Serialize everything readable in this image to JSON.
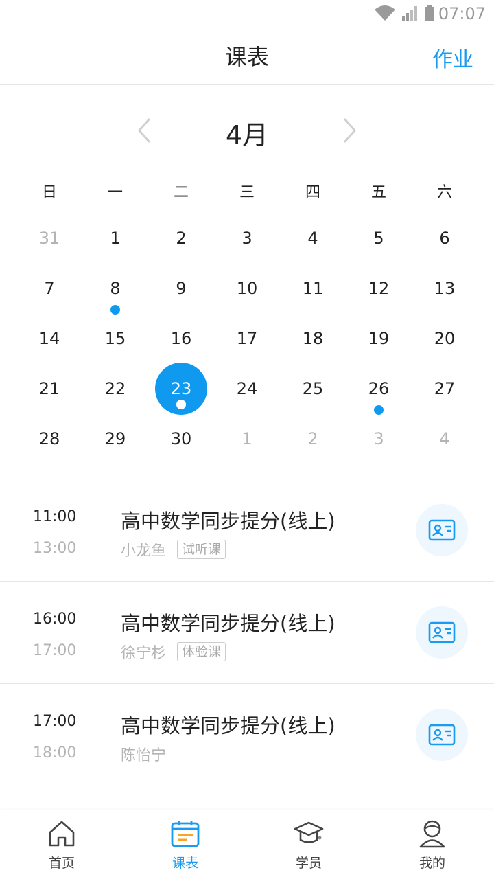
{
  "status": {
    "time": "07:07"
  },
  "header": {
    "title": "课表",
    "action": "作业"
  },
  "calendar": {
    "month": "4月",
    "weekdays": [
      "日",
      "一",
      "二",
      "三",
      "四",
      "五",
      "六"
    ],
    "weeks": [
      [
        {
          "d": "31",
          "other": true
        },
        {
          "d": "1"
        },
        {
          "d": "2"
        },
        {
          "d": "3"
        },
        {
          "d": "4"
        },
        {
          "d": "5"
        },
        {
          "d": "6"
        }
      ],
      [
        {
          "d": "7"
        },
        {
          "d": "8",
          "dot": true
        },
        {
          "d": "9"
        },
        {
          "d": "10"
        },
        {
          "d": "11"
        },
        {
          "d": "12"
        },
        {
          "d": "13"
        }
      ],
      [
        {
          "d": "14"
        },
        {
          "d": "15"
        },
        {
          "d": "16"
        },
        {
          "d": "17"
        },
        {
          "d": "18"
        },
        {
          "d": "19"
        },
        {
          "d": "20"
        }
      ],
      [
        {
          "d": "21"
        },
        {
          "d": "22"
        },
        {
          "d": "23",
          "selected": true,
          "dot": true
        },
        {
          "d": "24"
        },
        {
          "d": "25"
        },
        {
          "d": "26",
          "dot": true
        },
        {
          "d": "27"
        }
      ],
      [
        {
          "d": "28"
        },
        {
          "d": "29"
        },
        {
          "d": "30"
        },
        {
          "d": "1",
          "other": true
        },
        {
          "d": "2",
          "other": true
        },
        {
          "d": "3",
          "other": true
        },
        {
          "d": "4",
          "other": true
        }
      ]
    ]
  },
  "lessons": [
    {
      "start": "11:00",
      "end": "13:00",
      "title": "高中数学同步提分(线上)",
      "teacher": "小龙鱼",
      "tag": "试听课"
    },
    {
      "start": "16:00",
      "end": "17:00",
      "title": "高中数学同步提分(线上)",
      "teacher": "徐宁杉",
      "tag": "体验课"
    },
    {
      "start": "17:00",
      "end": "18:00",
      "title": "高中数学同步提分(线上)",
      "teacher": "陈怡宁",
      "tag": ""
    }
  ],
  "tabbar": {
    "items": [
      {
        "label": "首页",
        "icon": "home-icon",
        "active": false
      },
      {
        "label": "课表",
        "icon": "schedule-icon",
        "active": true
      },
      {
        "label": "学员",
        "icon": "graduation-cap-icon",
        "active": false
      },
      {
        "label": "我的",
        "icon": "profile-icon",
        "active": false
      }
    ]
  },
  "colors": {
    "accent": "#1a9bf0",
    "muted": "#b4b4b4",
    "text": "#222222"
  }
}
